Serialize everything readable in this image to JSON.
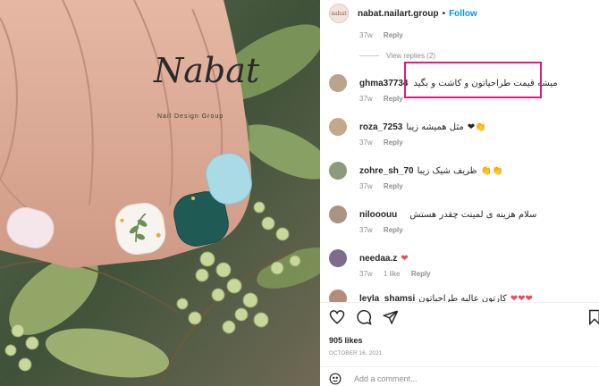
{
  "post": {
    "username": "nabat.nailart.group",
    "separator": "•",
    "follow_label": "Follow",
    "avatar_text": "nabat",
    "watermark_title": "Nabat",
    "watermark_sub": "Nail Design Group"
  },
  "comments": {
    "top_meta": {
      "age": "37w",
      "reply": "Reply"
    },
    "view_replies": "View replies (2)",
    "items": [
      {
        "username": "ghma37734",
        "text": "میشه قیمت طراحیاتون و کاشت و بگید",
        "age": "37w",
        "likes": "",
        "reply": "Reply"
      },
      {
        "username": "roza_7253",
        "text": "مثل همیشه زیبا",
        "emoji": "❤👏",
        "age": "37w",
        "likes": "",
        "reply": "Reply"
      },
      {
        "username": "zohre_sh_70",
        "text": "ظریف شیک زیبا",
        "emoji": "👏👏",
        "age": "37w",
        "likes": "",
        "reply": "Reply"
      },
      {
        "username": "nilooouu",
        "text": "سلام هزینه ی لمینت چقدر هستش",
        "emoji": "",
        "age": "37w",
        "likes": "",
        "reply": "Reply"
      },
      {
        "username": "needaa.z",
        "text": "",
        "emoji": "❤",
        "age": "37w",
        "likes": "1 like",
        "reply": "Reply"
      },
      {
        "username": "leyla_shamsi",
        "text": "کارتون عالیه طراحیاتون",
        "emoji": "❤❤❤",
        "age": "",
        "likes": "",
        "reply": ""
      }
    ]
  },
  "actions": {
    "like_icon": "heart-icon",
    "comment_icon": "comment-icon",
    "share_icon": "share-icon",
    "save_icon": "bookmark-icon"
  },
  "likes_text": "905 likes",
  "date_text": "OCTOBER 16, 2021",
  "add_comment": {
    "placeholder": "Add a comment..."
  },
  "colors": {
    "link": "#0095f6",
    "highlight": "#e2187c",
    "heart": "#ed4956",
    "muted": "#8e8e8e"
  }
}
